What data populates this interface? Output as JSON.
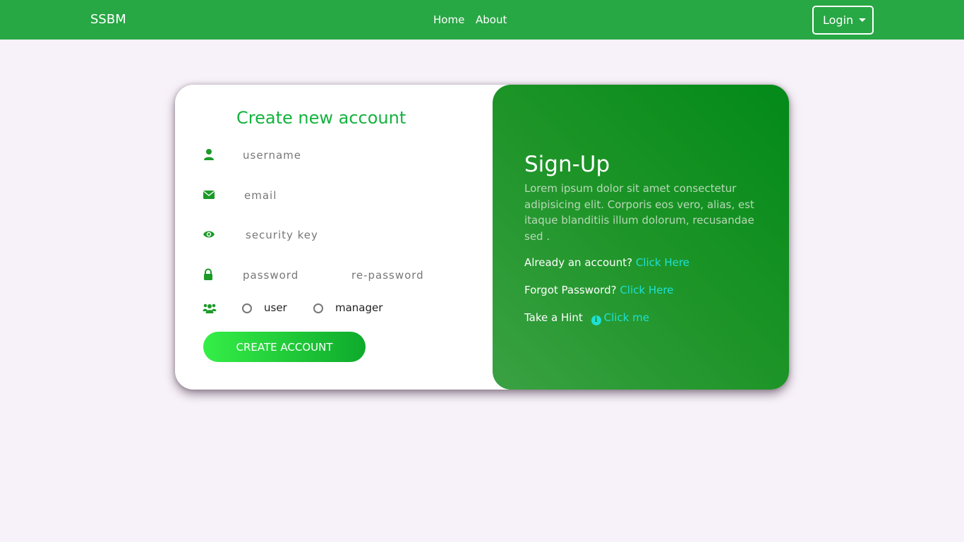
{
  "nav": {
    "brand": "SSBM",
    "links": [
      "Home",
      "About"
    ],
    "login_label": "Login"
  },
  "form": {
    "title": "Create new account",
    "username_placeholder": "username",
    "email_placeholder": "email",
    "security_key_placeholder": "security key",
    "password_placeholder": "password",
    "repassword_placeholder": "re-password",
    "roles": [
      "user",
      "manager"
    ],
    "submit_label": "CREATE ACCOUNT"
  },
  "panel": {
    "title": "Sign-Up",
    "description": "Lorem ipsum dolor sit amet consectetur adipisicing elit. Corporis eos vero, alias, est itaque blanditiis illum dolorum, recusandae sed .",
    "account_text": "Already an account?",
    "account_link": "Click Here",
    "forgot_text": "Forgot Password?",
    "forgot_link": "Click Here",
    "hint_text": "Take a Hint",
    "hint_link": "Click me"
  },
  "colors": {
    "navbar": "#28a745",
    "accent": "#14b33e",
    "link": "#1fe0d6",
    "background": "#f7f1f9"
  }
}
